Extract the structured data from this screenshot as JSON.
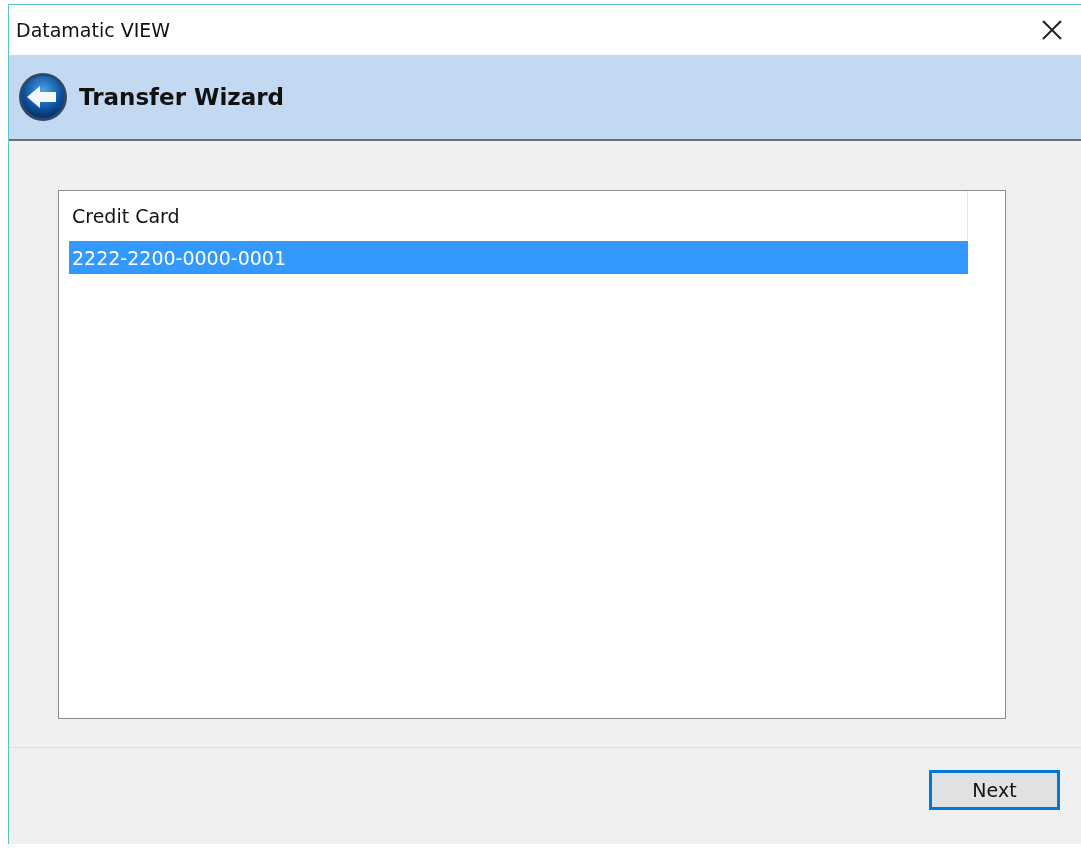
{
  "window": {
    "title": "Datamatic VIEW"
  },
  "header": {
    "title": "Transfer Wizard"
  },
  "list": {
    "columns": [
      "Credit Card"
    ],
    "rows": [
      {
        "cells": [
          "2222-2200-0000-0001"
        ],
        "selected": true
      }
    ]
  },
  "buttons": [
    {
      "label": "Next",
      "focused": true
    }
  ]
}
